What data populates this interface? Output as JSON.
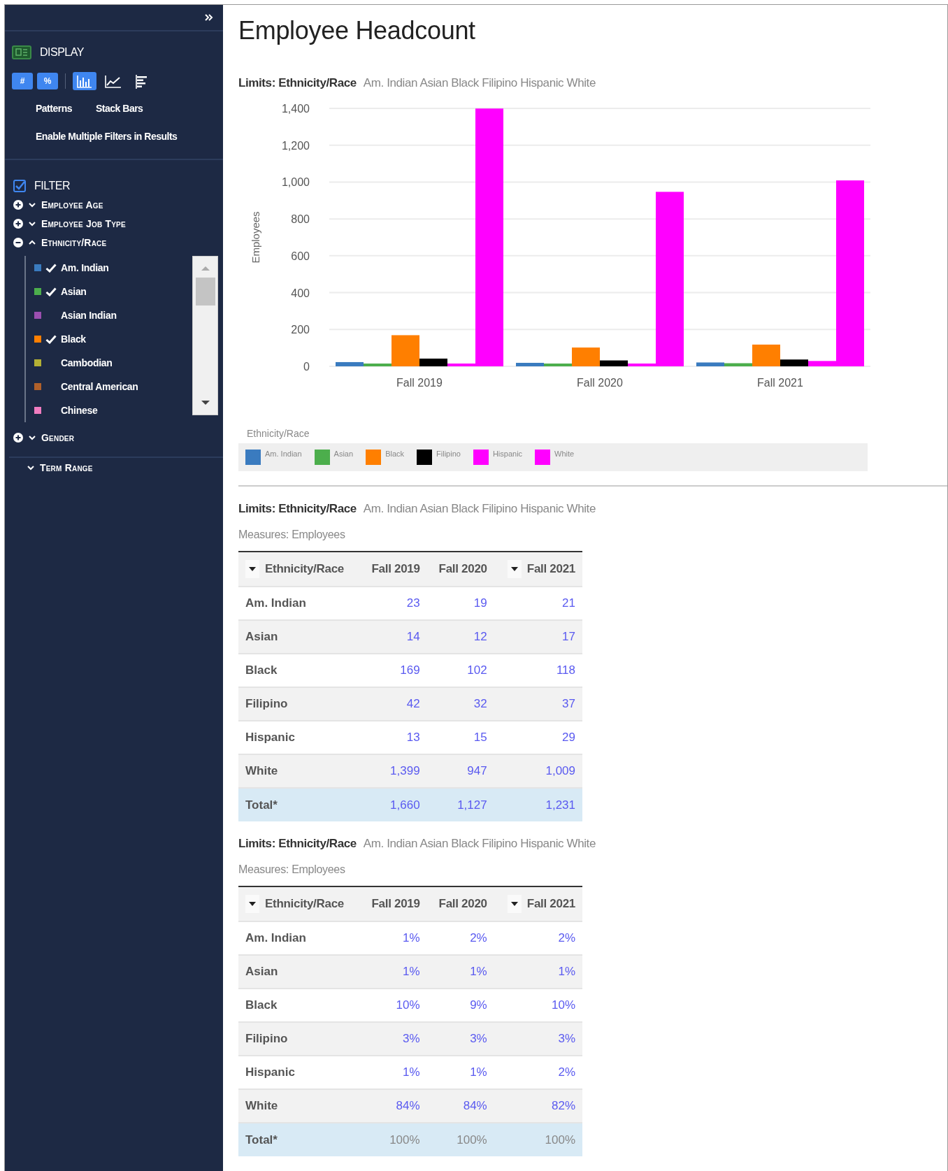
{
  "sidebar": {
    "display": {
      "title": "DISPLAY",
      "value_buttons": [
        {
          "label": "#",
          "selected": true
        },
        {
          "label": "%",
          "selected": true
        }
      ],
      "chart_types": [
        {
          "kind": "bar",
          "selected": true
        },
        {
          "kind": "line",
          "selected": false
        },
        {
          "kind": "hbar",
          "selected": false
        }
      ],
      "options": [
        "Patterns",
        "Stack Bars"
      ],
      "extra_option": "Enable Multiple Filters in Results"
    },
    "filter": {
      "title": "FILTER",
      "checked": true,
      "groups": [
        {
          "label": "Employee Age",
          "expanded": false
        },
        {
          "label": "Employee Job Type",
          "expanded": false
        },
        {
          "label": "Ethnicity/Race",
          "expanded": true,
          "children": [
            {
              "label": "Am. Indian",
              "color": "#3a7bbf",
              "checked": true
            },
            {
              "label": "Asian",
              "color": "#4cae4c",
              "checked": true
            },
            {
              "label": "Asian Indian",
              "color": "#9b4fb0",
              "checked": false
            },
            {
              "label": "Black",
              "color": "#ff7f00",
              "checked": true
            },
            {
              "label": "Cambodian",
              "color": "#b3b035",
              "checked": false
            },
            {
              "label": "Central American",
              "color": "#b0602a",
              "checked": false
            },
            {
              "label": "Chinese",
              "color": "#f07cc0",
              "checked": false
            }
          ]
        },
        {
          "label": "Gender",
          "expanded": false
        }
      ],
      "term_range": "Term Range"
    }
  },
  "main": {
    "title": "Employee Headcount",
    "chart_limits": {
      "label": "Limits: Ethnicity/Race",
      "values": "Am. Indian Asian Black Filipino Hispanic White"
    },
    "chart_data": {
      "type": "bar",
      "ylabel": "Employees",
      "categories": [
        "Fall 2019",
        "Fall 2020",
        "Fall 2021"
      ],
      "ylim": [
        0,
        1400
      ],
      "grid": true,
      "yticks": [
        0,
        200,
        400,
        600,
        800,
        {
          "value": 1000,
          "label": "1,000"
        },
        {
          "value": 1200,
          "label": "1,200"
        },
        {
          "value": 1400,
          "label": "1,400"
        }
      ],
      "series": [
        {
          "name": "Am. Indian",
          "color": "#3a7bbf",
          "values": [
            23,
            19,
            21
          ]
        },
        {
          "name": "Asian",
          "color": "#4cae4c",
          "values": [
            14,
            12,
            17
          ]
        },
        {
          "name": "Black",
          "color": "#ff7f00",
          "values": [
            169,
            102,
            118
          ]
        },
        {
          "name": "Filipino",
          "color": "#000000",
          "values": [
            42,
            32,
            37
          ]
        },
        {
          "name": "Hispanic",
          "color": "#ff00ff",
          "values": [
            13,
            15,
            29
          ]
        },
        {
          "name": "White",
          "color": "#ff00ff",
          "values": [
            1399,
            947,
            1009
          ]
        }
      ]
    },
    "legend_title": "Ethnicity/Race",
    "tables": [
      {
        "limits": {
          "label": "Limits: Ethnicity/Race",
          "values": "Am. Indian Asian Black Filipino Hispanic White"
        },
        "measures": "Measures: Employees",
        "columns": [
          {
            "label": "Ethnicity/Race",
            "sort_caret": true
          },
          {
            "label": "Fall 2019",
            "sort_caret": false
          },
          {
            "label": "Fall 2020",
            "sort_caret": false
          },
          {
            "label": "Fall 2021",
            "sort_caret": true
          }
        ],
        "rows": [
          {
            "kind": "data",
            "label": "Am. Indian",
            "values": [
              "23",
              "19",
              "21"
            ]
          },
          {
            "kind": "data",
            "label": "Asian",
            "values": [
              "14",
              "12",
              "17"
            ]
          },
          {
            "kind": "data",
            "label": "Black",
            "values": [
              "169",
              "102",
              "118"
            ]
          },
          {
            "kind": "data",
            "label": "Filipino",
            "values": [
              "42",
              "32",
              "37"
            ]
          },
          {
            "kind": "data",
            "label": "Hispanic",
            "values": [
              "13",
              "15",
              "29"
            ]
          },
          {
            "kind": "data",
            "label": "White",
            "values": [
              "1,399",
              "947",
              "1,009"
            ]
          },
          {
            "kind": "total",
            "label": "Total*",
            "values": [
              "1,660",
              "1,127",
              "1,231"
            ],
            "muted": false
          }
        ]
      },
      {
        "limits": {
          "label": "Limits: Ethnicity/Race",
          "values": "Am. Indian Asian Black Filipino Hispanic White"
        },
        "measures": "Measures: Employees",
        "columns": [
          {
            "label": "Ethnicity/Race",
            "sort_caret": true
          },
          {
            "label": "Fall 2019",
            "sort_caret": false
          },
          {
            "label": "Fall 2020",
            "sort_caret": false
          },
          {
            "label": "Fall 2021",
            "sort_caret": true
          }
        ],
        "rows": [
          {
            "kind": "data",
            "label": "Am. Indian",
            "values": [
              "1%",
              "2%",
              "2%"
            ]
          },
          {
            "kind": "data",
            "label": "Asian",
            "values": [
              "1%",
              "1%",
              "1%"
            ]
          },
          {
            "kind": "data",
            "label": "Black",
            "values": [
              "10%",
              "9%",
              "10%"
            ]
          },
          {
            "kind": "data",
            "label": "Filipino",
            "values": [
              "3%",
              "3%",
              "3%"
            ]
          },
          {
            "kind": "data",
            "label": "Hispanic",
            "values": [
              "1%",
              "1%",
              "2%"
            ]
          },
          {
            "kind": "data",
            "label": "White",
            "values": [
              "84%",
              "84%",
              "82%"
            ]
          },
          {
            "kind": "total",
            "label": "Total*",
            "values": [
              "100%",
              "100%",
              "100%"
            ],
            "muted": true
          }
        ]
      }
    ]
  }
}
